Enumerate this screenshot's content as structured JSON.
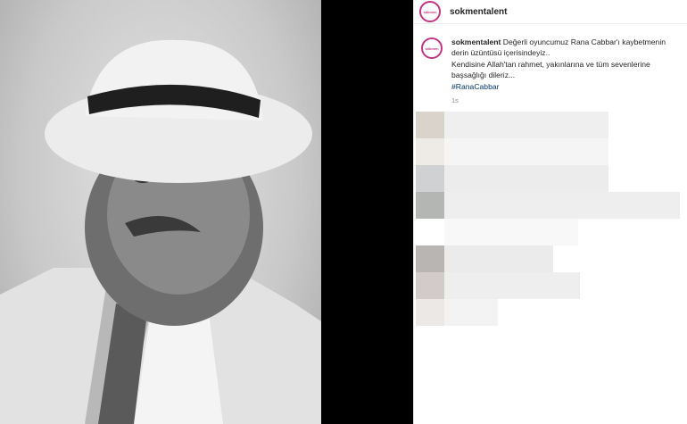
{
  "post": {
    "username": "sokmentalent",
    "avatar_text": "sökmen",
    "caption_line1": "Değerli oyuncumuz Rana Cabbar'ı kaybetmenin derin üzüntüsü içerisindeyiz..",
    "caption_line2": "Kendisine Allah'tan rahmet, yakınlarına ve tüm sevenlerine başsağlığı dileriz...",
    "hashtag": "#RanaCabbar",
    "time": "1s"
  },
  "colors": {
    "accent": "#c13584",
    "link": "#00376b",
    "muted": "#8e8e8e"
  }
}
